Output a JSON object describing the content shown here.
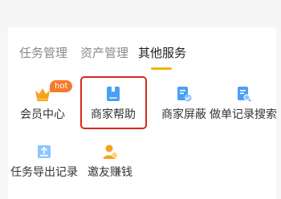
{
  "tabs": [
    {
      "label": "任务管理",
      "active": false
    },
    {
      "label": "资产管理",
      "active": false
    },
    {
      "label": "其他服务",
      "active": true
    }
  ],
  "services": [
    {
      "label": "会员中心",
      "icon": "crown-icon",
      "badge": "hot"
    },
    {
      "label": "商家帮助",
      "icon": "book-icon",
      "highlighted": true
    },
    {
      "label": "商家屏蔽",
      "icon": "shield-doc-icon"
    },
    {
      "label": "做单记录搜索",
      "icon": "search-doc-icon"
    },
    {
      "label": "任务导出记录",
      "icon": "export-doc-icon"
    },
    {
      "label": "邀友赚钱",
      "icon": "invite-user-icon"
    }
  ],
  "colors": {
    "accent": "#f5b400",
    "badge": "#f57a2c",
    "highlight_border": "#d9281c",
    "icon_blue": "#4a9ff5",
    "icon_orange": "#f7a21b"
  }
}
